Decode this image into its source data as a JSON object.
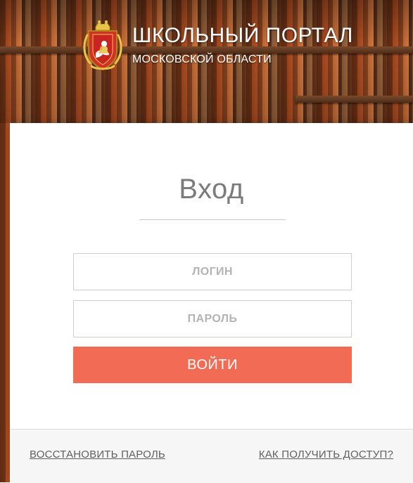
{
  "header": {
    "title": "ШКОЛЬНЫЙ ПОРТАЛ",
    "subtitle": "МОСКОВСКОЙ ОБЛАСТИ",
    "logo_icon": "moscow-region-coat-of-arms-icon"
  },
  "login": {
    "title": "Вход",
    "login_placeholder": "ЛОГИН",
    "password_placeholder": "ПАРОЛЬ",
    "submit_label": "ВОЙТИ"
  },
  "footer": {
    "restore_password": "ВОССТАНОВИТЬ ПАРОЛЬ",
    "get_access": "КАК ПОЛУЧИТЬ ДОСТУП?"
  },
  "colors": {
    "accent_button": "#f26b55"
  }
}
